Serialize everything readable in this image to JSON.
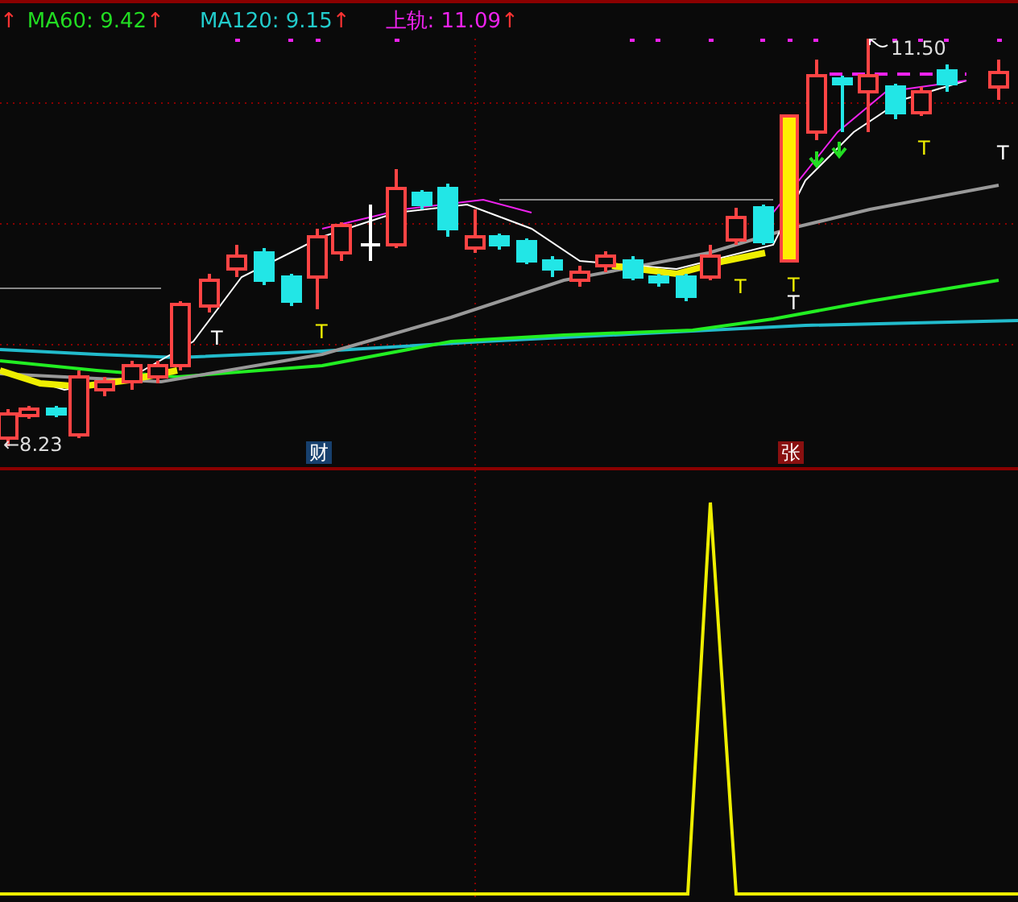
{
  "legend": {
    "lead_arrow": "↑",
    "items": [
      {
        "label": "MA60:",
        "value": "9.42",
        "arrow": "↑",
        "color": "#22dd22"
      },
      {
        "label": "MA120:",
        "value": "9.15",
        "arrow": "↑",
        "color": "#22cccc"
      },
      {
        "label": "上轨:",
        "value": "11.09",
        "arrow": "↑",
        "color": "#ee22ee"
      }
    ]
  },
  "price_labels": [
    {
      "kind": "high",
      "text": "11.50"
    },
    {
      "kind": "low",
      "text": "←8.23"
    }
  ],
  "signal_marks": [
    {
      "text": "T",
      "color": "#ffffff"
    },
    {
      "text": "T",
      "color": "#eeee00"
    },
    {
      "text": "T",
      "color": "#eeee00"
    },
    {
      "text": "T",
      "color": "#eeee00"
    },
    {
      "text": "T",
      "color": "#ffffff"
    },
    {
      "text": "T",
      "color": "#eeee00"
    },
    {
      "text": "T",
      "color": "#ffffff"
    }
  ],
  "event_badges": [
    {
      "text": "财",
      "color": "#17406e"
    },
    {
      "text": "张",
      "color": "#8a1010"
    }
  ]
}
